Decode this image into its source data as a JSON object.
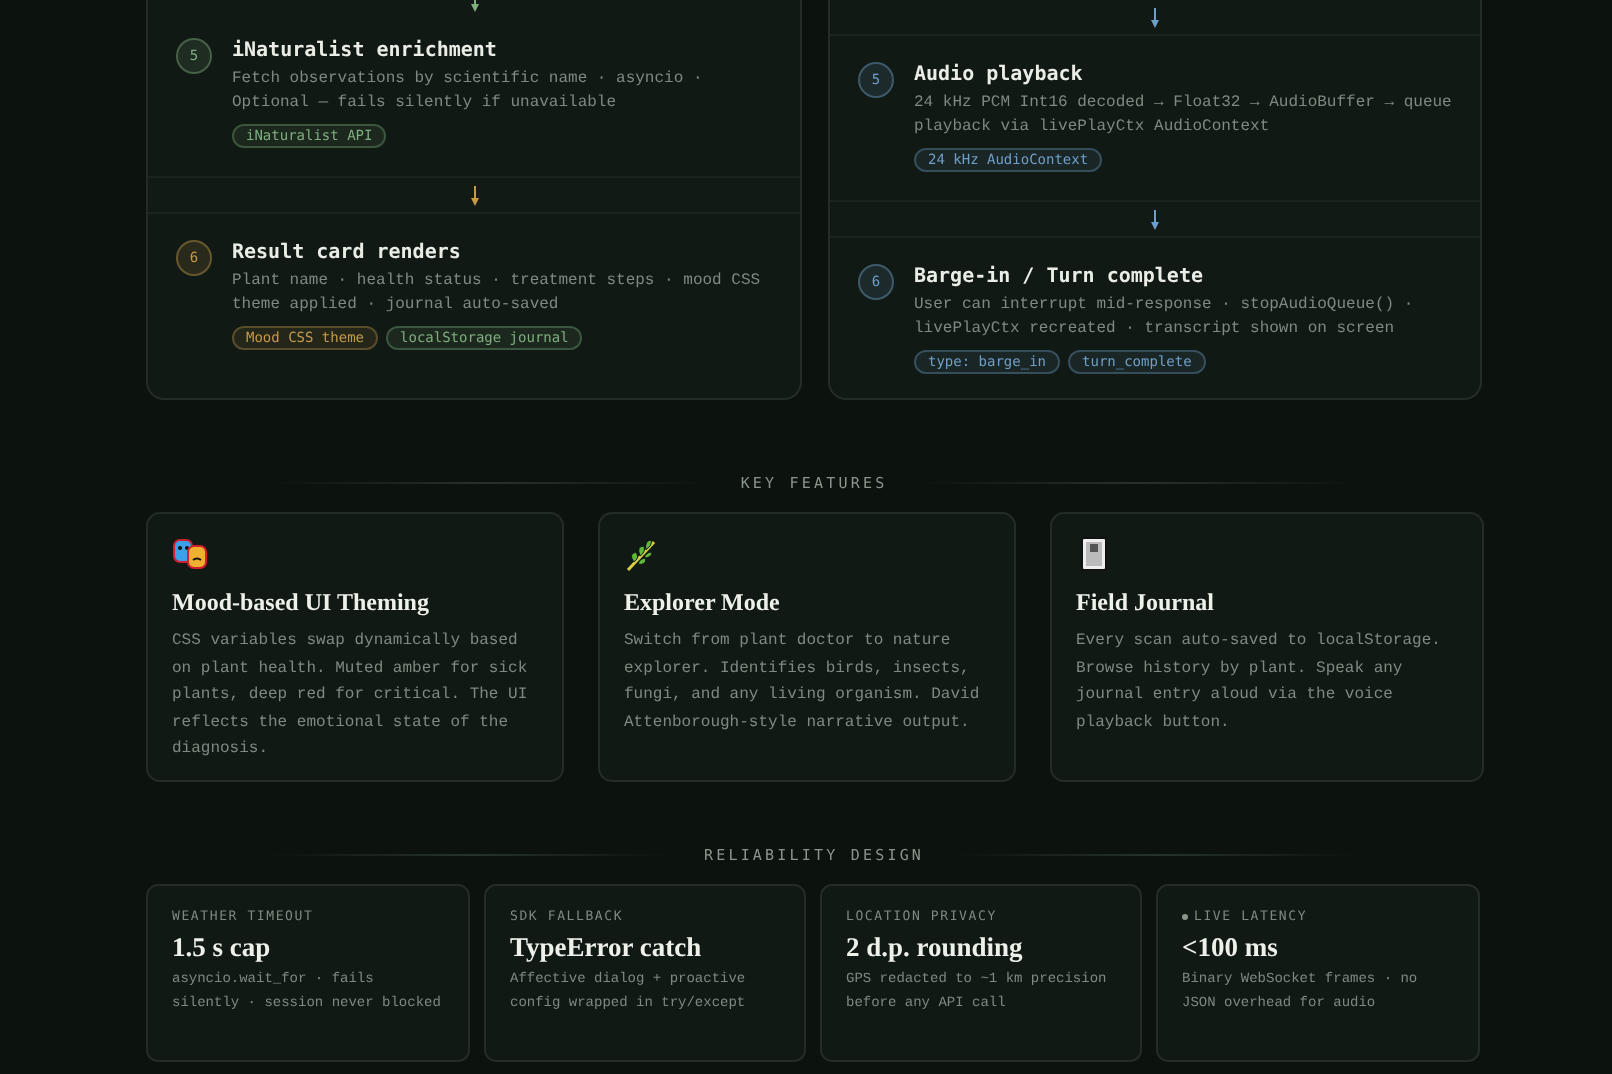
{
  "pipelines": [
    {
      "steps": [
        {
          "number": "5",
          "color": "#7fae7f",
          "title": "iNaturalist enrichment",
          "description": "Fetch observations by scientific name · asyncio · Optional — fails silently if unavailable",
          "tags": [
            {
              "label": "iNaturalist API",
              "color": "#7fae7f"
            }
          ]
        },
        {
          "number": "6",
          "color": "#c79a4a",
          "title": "Result card renders",
          "description": "Plant name · health status · treatment steps · mood CSS theme applied · journal auto-saved",
          "tags": [
            {
              "label": "Mood CSS theme",
              "color": "#c79a4a"
            },
            {
              "label": "localStorage journal",
              "color": "#7fae7f"
            }
          ]
        }
      ]
    },
    {
      "steps": [
        {
          "number": "5",
          "color": "#6f9fc9",
          "title": "Audio playback",
          "description": "24 kHz PCM Int16 decoded → Float32 → AudioBuffer → queue playback via livePlayCtx AudioContext",
          "tags": [
            {
              "label": "24 kHz AudioContext",
              "color": "#6f9fc9"
            }
          ]
        },
        {
          "number": "6",
          "color": "#6f9fc9",
          "title": "Barge-in / Turn complete",
          "description": "User can interrupt mid-response · stopAudioQueue() · livePlayCtx recreated · transcript shown on screen",
          "tags": [
            {
              "label": "type: barge_in",
              "color": "#6f9fc9"
            },
            {
              "label": "turn_complete",
              "color": "#6f9fc9"
            }
          ]
        }
      ]
    }
  ],
  "key_features": {
    "heading": "KEY FEATURES",
    "cards": [
      {
        "kind": "masks",
        "title": "Mood-based UI Theming",
        "description": "CSS variables swap dynamically based on plant health. Muted amber for sick plants, deep red for critical. The UI reflects the emotional state of the diagnosis."
      },
      {
        "kind": "leaf",
        "title": "Explorer Mode",
        "description": "Switch from plant doctor to nature explorer. Identifies birds, insects, fungi, and any living organism. David Attenborough-style narrative output."
      },
      {
        "kind": "notebook",
        "title": "Field Journal",
        "description": "Every scan auto-saved to localStorage. Browse history by plant. Speak any journal entry aloud via the voice playback button."
      }
    ]
  },
  "reliability_design": {
    "heading": "RELIABILITY DESIGN",
    "cards": [
      {
        "label": "WEATHER TIMEOUT",
        "live": false,
        "value": "1.5 s cap",
        "description": "asyncio.wait_for · fails silently · session never blocked"
      },
      {
        "label": "SDK FALLBACK",
        "live": false,
        "value": "TypeError catch",
        "description": "Affective dialog + proactive config wrapped in try/except"
      },
      {
        "label": "LOCATION PRIVACY",
        "live": false,
        "value": "2 d.p. rounding",
        "description": "GPS redacted to ~1 km precision before any API call"
      },
      {
        "label": "LIVE LATENCY",
        "live": true,
        "value": "<100 ms",
        "description": "Binary WebSocket frames · no JSON overhead for audio"
      }
    ]
  }
}
